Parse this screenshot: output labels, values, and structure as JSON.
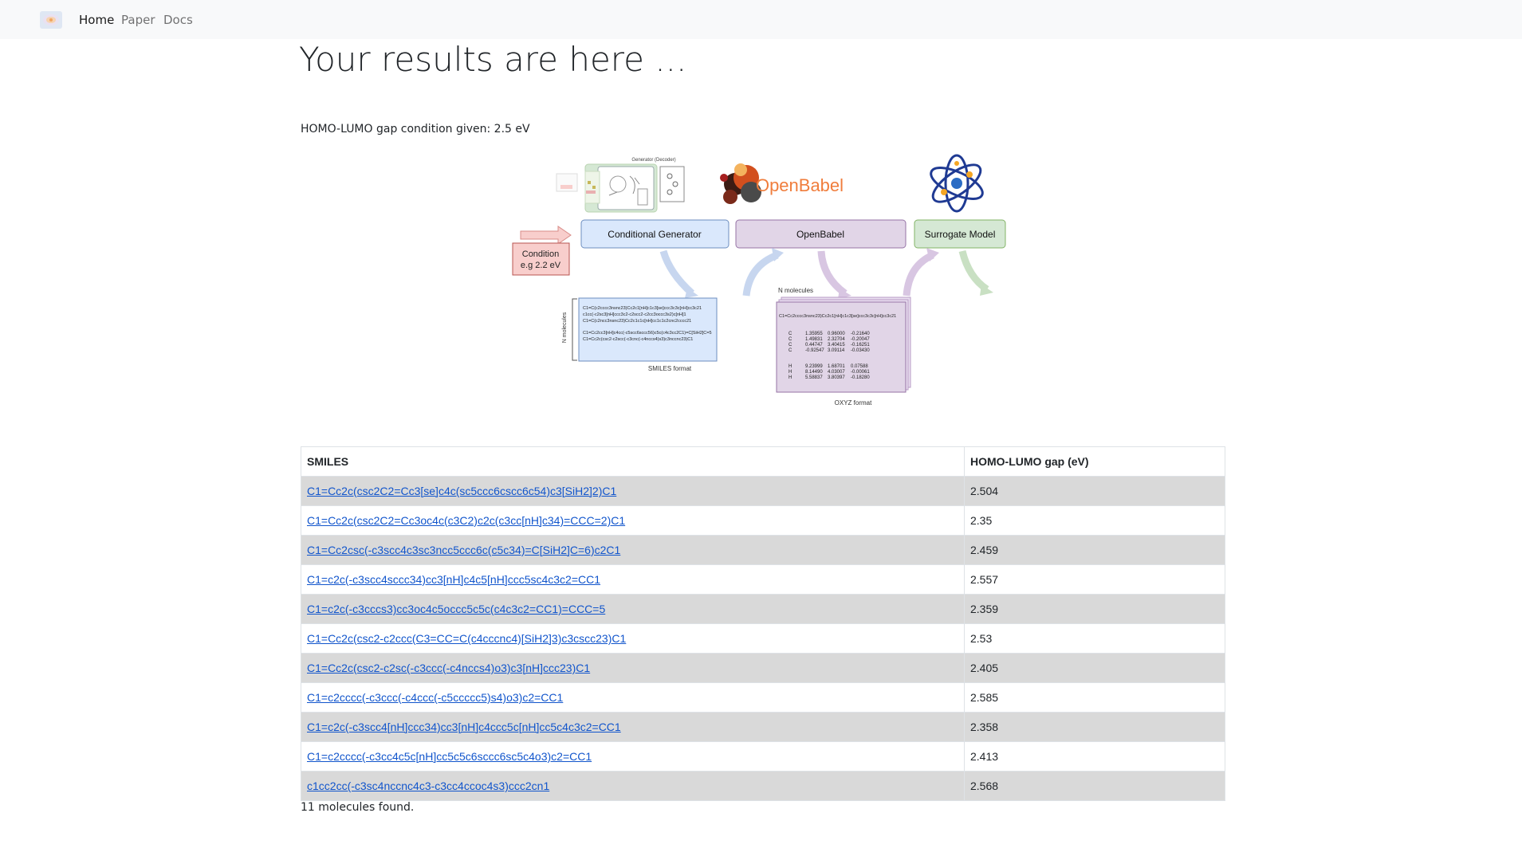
{
  "nav": {
    "logo_icon": "app-logo-icon",
    "items": [
      {
        "label": "Home",
        "active": true
      },
      {
        "label": "Paper",
        "active": false
      },
      {
        "label": "Docs",
        "active": false
      }
    ]
  },
  "page": {
    "title": "Your results are here ...",
    "condition_text": "HOMO-LUMO gap condition given: 2.5 eV"
  },
  "diagram": {
    "generator_caption": "Generator (Decoder)",
    "condition_label": "Condition",
    "condition_value": "e.g 2.2 eV",
    "conditional_generator": "Conditional Generator",
    "openbabel_logo": "OpenBabel",
    "openbabel_box": "OpenBabel",
    "surrogate_model": "Surrogate Model",
    "n_molecules_vertical": "N molecules",
    "n_molecules": "N molecules",
    "smiles_format": "SMILES format",
    "oxyz_format": "OXYZ format",
    "smiles_lines": [
      "C1=C(c2cccc3nsnc23)Cc2c1[nH]c1c3[se]ccc3c3c[nH]cc3c21",
      "c1cc(-c2sc3[nH]ccc3c2-c2scc2-c2cc3occc3s2)c[nH]1",
      "C1=C(c2ncc3nsnc23)Cc2c1c1c[nH]cc1c1c2cnc2cccc21",
      "C1=Cc2cc3[nH]c4cc(-c5scc6sccc56)c5c(c4c3cc2C1)=C[SiH2]C=5",
      "C1=Cc2c(csc2-c2scc(-c3cnc(-c4nccs4)s3)c3nccnc23)C1"
    ],
    "xyz_header": "C1=Cc2cccc3nsnc23)Cc2c1[nH]c1c3[se]ccc3c3c[nH]cc3c21",
    "xyz_rows": [
      [
        "C",
        "1.35955",
        "0.96000",
        "-0.21640"
      ],
      [
        "C",
        "1.49831",
        "2.32704",
        "-0.20047"
      ],
      [
        "C",
        "0.44747",
        "3.40415",
        "-0.16251"
      ],
      [
        "C",
        "-0.92547",
        "3.09114",
        "-0.03430"
      ],
      [
        "H",
        "9.23999",
        "1.68701",
        "0.07588"
      ],
      [
        "H",
        "8.14490",
        "4.03007",
        "-0.00061"
      ],
      [
        "H",
        "5.58837",
        "3.80397",
        "-0.18280"
      ]
    ]
  },
  "table": {
    "headers": [
      "SMILES",
      "HOMO-LUMO gap (eV)"
    ],
    "rows": [
      {
        "smiles": "C1=Cc2c(csc2C2=Cc3[se]c4c(sc5ccc6cscc6c54)c3[SiH2]2)C1",
        "gap": "2.504"
      },
      {
        "smiles": "C1=Cc2c(csc2C2=Cc3oc4c(c3C2)c2c(c3cc[nH]c34)=CCC=2)C1",
        "gap": "2.35"
      },
      {
        "smiles": "C1=Cc2csc(-c3scc4c3sc3ncc5ccc6c(c5c34)=C[SiH2]C=6)c2C1",
        "gap": "2.459"
      },
      {
        "smiles": "C1=c2c(-c3scc4sccc34)cc3[nH]c4c5[nH]ccc5sc4c3c2=CC1",
        "gap": "2.557"
      },
      {
        "smiles": "C1=c2c(-c3cccs3)cc3oc4c5occc5c5c(c4c3c2=CC1)=CCC=5",
        "gap": "2.359"
      },
      {
        "smiles": "C1=Cc2c(csc2-c2ccc(C3=CC=C(c4cccnc4)[SiH2]3)c3cscc23)C1",
        "gap": "2.53"
      },
      {
        "smiles": "C1=Cc2c(csc2-c2sc(-c3ccc(-c4nccs4)o3)c3[nH]ccc23)C1",
        "gap": "2.405"
      },
      {
        "smiles": "C1=c2cccc(-c3ccc(-c4ccc(-c5ccccc5)s4)o3)c2=CC1",
        "gap": "2.585"
      },
      {
        "smiles": "C1=c2c(-c3scc4[nH]ccc34)cc3[nH]c4ccc5c[nH]cc5c4c3c2=CC1",
        "gap": "2.358"
      },
      {
        "smiles": "C1=c2cccc(-c3cc4c5c[nH]cc5c5c6sccc6sc5c4o3)c2=CC1",
        "gap": "2.413"
      },
      {
        "smiles": "c1cc2cc(-c3sc4nccnc4c3-c3cc4ccoc4s3)ccc2cn1",
        "gap": "2.568"
      }
    ],
    "count_text": "11 molecules found."
  },
  "colors": {
    "navbar_bg": "#f8f9fa",
    "link": "#1155cc",
    "stripe": "#d9d9d9",
    "generator_box": "#dae8fc",
    "openbabel_box": "#e1d5e7",
    "surrogate_box": "#d5e8d4",
    "condition_box": "#f8cecc",
    "openbabel_orange": "#f07d3c"
  }
}
